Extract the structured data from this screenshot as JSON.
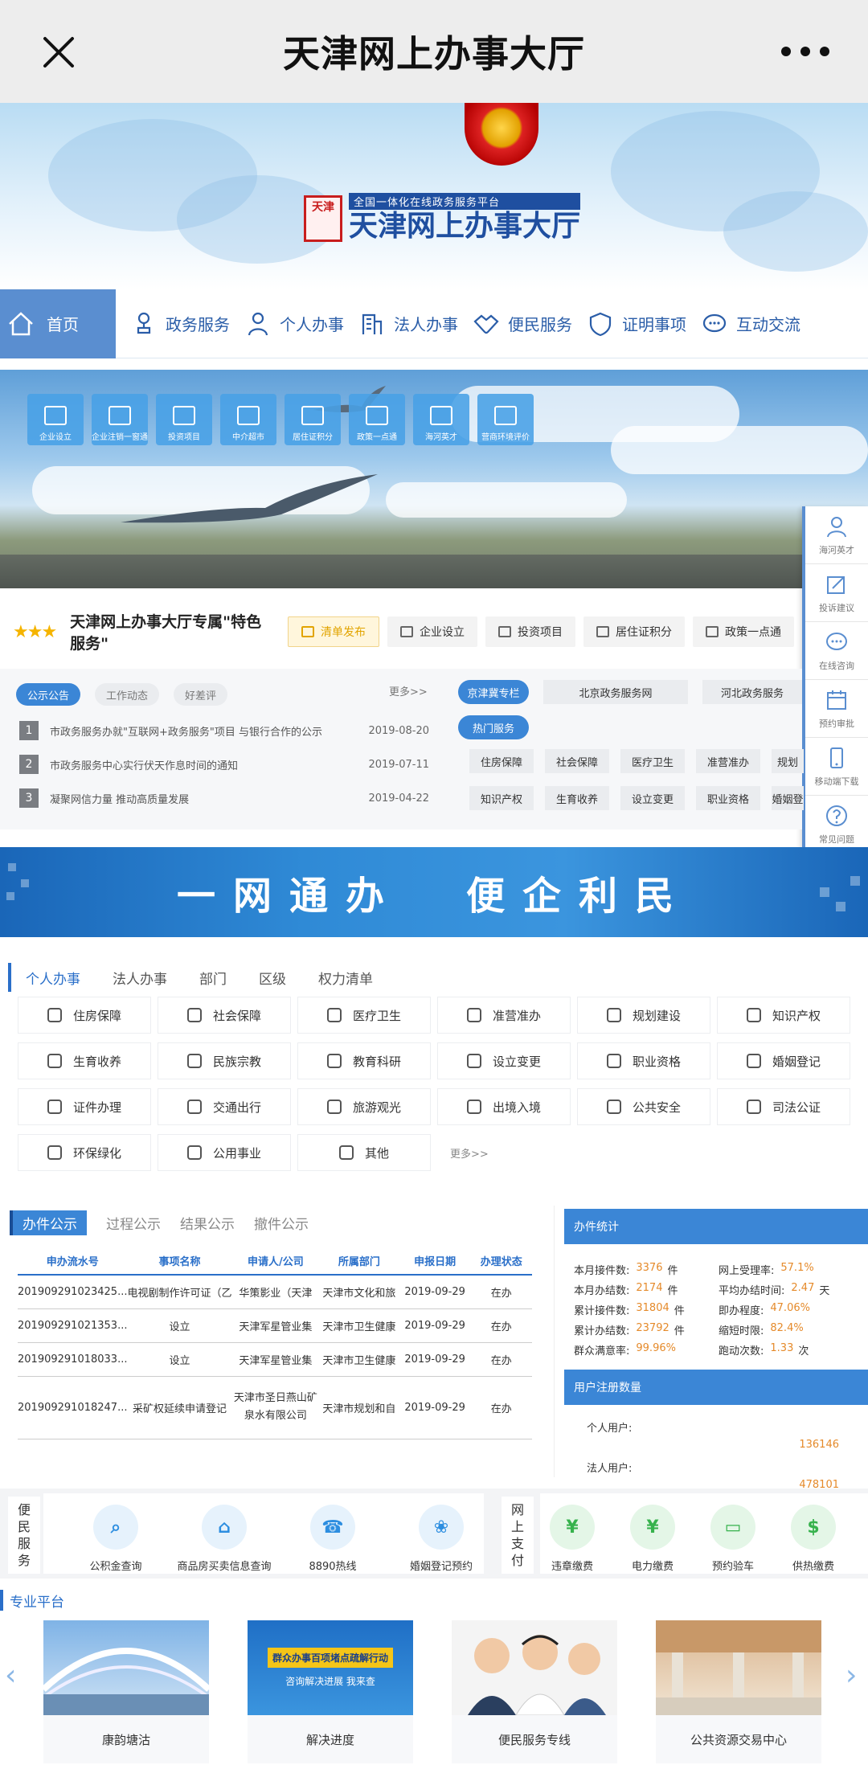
{
  "topbar": {
    "title": "天津网上办事大厅"
  },
  "banner": {
    "logo_seal": "天津",
    "logo_sub": "全国一体化在线政务服务平台",
    "logo_main": "天津网上办事大厅"
  },
  "nav": {
    "home": "首页",
    "items": [
      "政务服务",
      "个人办事",
      "法人办事",
      "便民服务",
      "证明事项",
      "互动交流"
    ]
  },
  "hero": {
    "tiles": [
      "企业设立",
      "企业注销一窗通",
      "投资项目",
      "中介超市",
      "居住证积分",
      "政策一点通",
      "海河英才",
      "营商环境评价"
    ]
  },
  "side": {
    "items": [
      "海河英才",
      "投诉建议",
      "在线咨询",
      "预约审批",
      "移动端下载",
      "常见问题"
    ]
  },
  "special": {
    "title": "天津网上办事大厅专属\"特色服务\"",
    "chips": [
      "清单发布",
      "企业设立",
      "投资项目",
      "居住证积分",
      "政策一点通"
    ]
  },
  "annc": {
    "tabs": [
      "公示公告",
      "工作动态",
      "好差评"
    ],
    "more": "更多>>",
    "rows": [
      {
        "num": "1",
        "text": "市政务服务办就\"互联网+政务服务\"项目 与银行合作的公示",
        "date": "2019-08-20"
      },
      {
        "num": "2",
        "text": "市政务服务中心实行伏天作息时间的通知",
        "date": "2019-07-11"
      },
      {
        "num": "3",
        "text": "凝聚网信力量 推动高质量发展",
        "date": "2019-04-22"
      }
    ],
    "jjj": "京津冀专栏",
    "jjj_items": [
      "北京政务服务网",
      "河北政务服务"
    ],
    "hot": "热门服务",
    "hot_row1": [
      "住房保障",
      "社会保障",
      "医疗卫生",
      "准营准办",
      "规划"
    ],
    "hot_row2": [
      "知识产权",
      "生育收养",
      "设立变更",
      "职业资格",
      "婚姻登"
    ]
  },
  "slogan": {
    "left": "一网通办",
    "right": "便企利民"
  },
  "category": {
    "tabs": [
      "个人办事",
      "法人办事",
      "部门",
      "区级",
      "权力清单"
    ],
    "items": [
      "住房保障",
      "社会保障",
      "医疗卫生",
      "准营准办",
      "规划建设",
      "知识产权",
      "生育收养",
      "民族宗教",
      "教育科研",
      "设立变更",
      "职业资格",
      "婚姻登记",
      "证件办理",
      "交通出行",
      "旅游观光",
      "出境入境",
      "公共安全",
      "司法公证",
      "环保绿化",
      "公用事业",
      "其他"
    ],
    "more": "更多>>"
  },
  "gongshi": {
    "tabs": [
      "办件公示",
      "过程公示",
      "结果公示",
      "撤件公示"
    ],
    "headers": [
      "申办流水号",
      "事项名称",
      "申请人/公司",
      "所属部门",
      "申报日期",
      "办理状态"
    ],
    "rows": [
      [
        "20190929102342​5...",
        "电视剧制作许可证（乙",
        "华策影业（天津",
        "天津市文化和旅",
        "2019-09-29",
        "在办"
      ],
      [
        "20190929102135​3...",
        "设立",
        "天津军星管业集",
        "天津市卫生健康",
        "2019-09-29",
        "在办"
      ],
      [
        "20190929101803​3...",
        "设立",
        "天津军星管业集",
        "天津市卫生健康",
        "2019-09-29",
        "在办"
      ],
      [
        "20190929101824​7...",
        "采矿权延续申请登记",
        "天津市圣日燕山矿泉水有限公司",
        "天津市规划和自",
        "2019-09-29",
        "在办"
      ]
    ]
  },
  "stats": {
    "title": "办件统计",
    "rows": [
      [
        {
          "l": "本月接件数:",
          "v": "3376",
          "u": "件"
        },
        {
          "l": "网上受理率:",
          "v": "57.1%",
          "u": ""
        }
      ],
      [
        {
          "l": "本月办结数:",
          "v": "2174",
          "u": "件"
        },
        {
          "l": "平均办结时间:",
          "v": "2.47",
          "u": "天"
        }
      ],
      [
        {
          "l": "累计接件数:",
          "v": "31804",
          "u": "件"
        },
        {
          "l": "即办程度:",
          "v": "47.06%",
          "u": ""
        }
      ],
      [
        {
          "l": "累计办结数:",
          "v": "23792",
          "u": "件"
        },
        {
          "l": "缩短时限:",
          "v": "82.4%",
          "u": ""
        }
      ],
      [
        {
          "l": "群众满意率:",
          "v": "99.96%",
          "u": ""
        },
        {
          "l": "跑动次数:",
          "v": "1.33",
          "u": "次"
        }
      ]
    ]
  },
  "users": {
    "title": "用户注册数量",
    "personal_label": "个人用户:",
    "personal_value": "136146",
    "legal_label": "法人用户:",
    "legal_value": "478101"
  },
  "services": {
    "label_left": "便民服务",
    "left": [
      "公积金查询",
      "商品房买卖信息查询",
      "8890热线",
      "婚姻登记预约"
    ],
    "label_right": "网上支付",
    "right": [
      "违章缴费",
      "电力缴费",
      "预约验车",
      "供热缴费"
    ],
    "colors": {
      "left": "#2d8ee0",
      "right": "#37b24d"
    }
  },
  "pro": {
    "title": "专业平台",
    "cards": [
      "康韵塘沽",
      "解决进度",
      "便民服务专线",
      "公共资源交易中心"
    ],
    "card2_banner": "群众办事百项堵点疏解行动",
    "card2_sub": "咨询解决进展 我来查"
  }
}
